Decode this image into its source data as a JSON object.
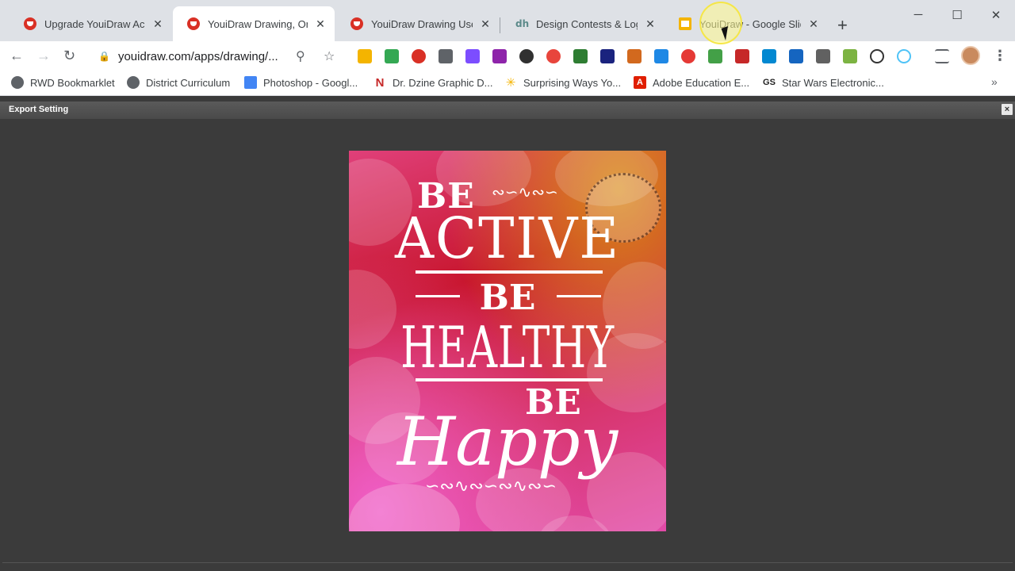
{
  "tabs": [
    {
      "title": "Upgrade YouiDraw Acco",
      "favicon": "youidraw-icon"
    },
    {
      "title": "YouiDraw Drawing, Onlin",
      "favicon": "youidraw-icon"
    },
    {
      "title": "YouiDraw Drawing User",
      "favicon": "youidraw-icon"
    },
    {
      "title": "Design Contests & Logo",
      "favicon": "designhill-icon"
    },
    {
      "title": "YouiDraw - Google Slide",
      "favicon": "google-slides-icon"
    }
  ],
  "toolbar": {
    "url": "youidraw.com/apps/drawing/..."
  },
  "bookmarks": [
    {
      "label": "RWD Bookmarklet"
    },
    {
      "label": "District Curriculum"
    },
    {
      "label": "Photoshop - Googl..."
    },
    {
      "label": "Dr. Dzine Graphic D..."
    },
    {
      "label": "Surprising Ways Yo..."
    },
    {
      "label": "Adobe Education E..."
    },
    {
      "label": "Star Wars Electronic..."
    }
  ],
  "dialog": {
    "title": "Export Setting",
    "close_label": "×"
  },
  "poster": {
    "line1": "BE",
    "line2": "ACTIVE",
    "line3": "BE",
    "line4": "HEALTHY",
    "line5": "BE",
    "line6": "Happy"
  },
  "colors": {
    "tabstrip_bg": "#dee1e6",
    "app_bg": "#3b3b3b",
    "poster_red": "#c8162e",
    "poster_pink": "#e24aa8",
    "poster_orange": "#d98a1a"
  }
}
